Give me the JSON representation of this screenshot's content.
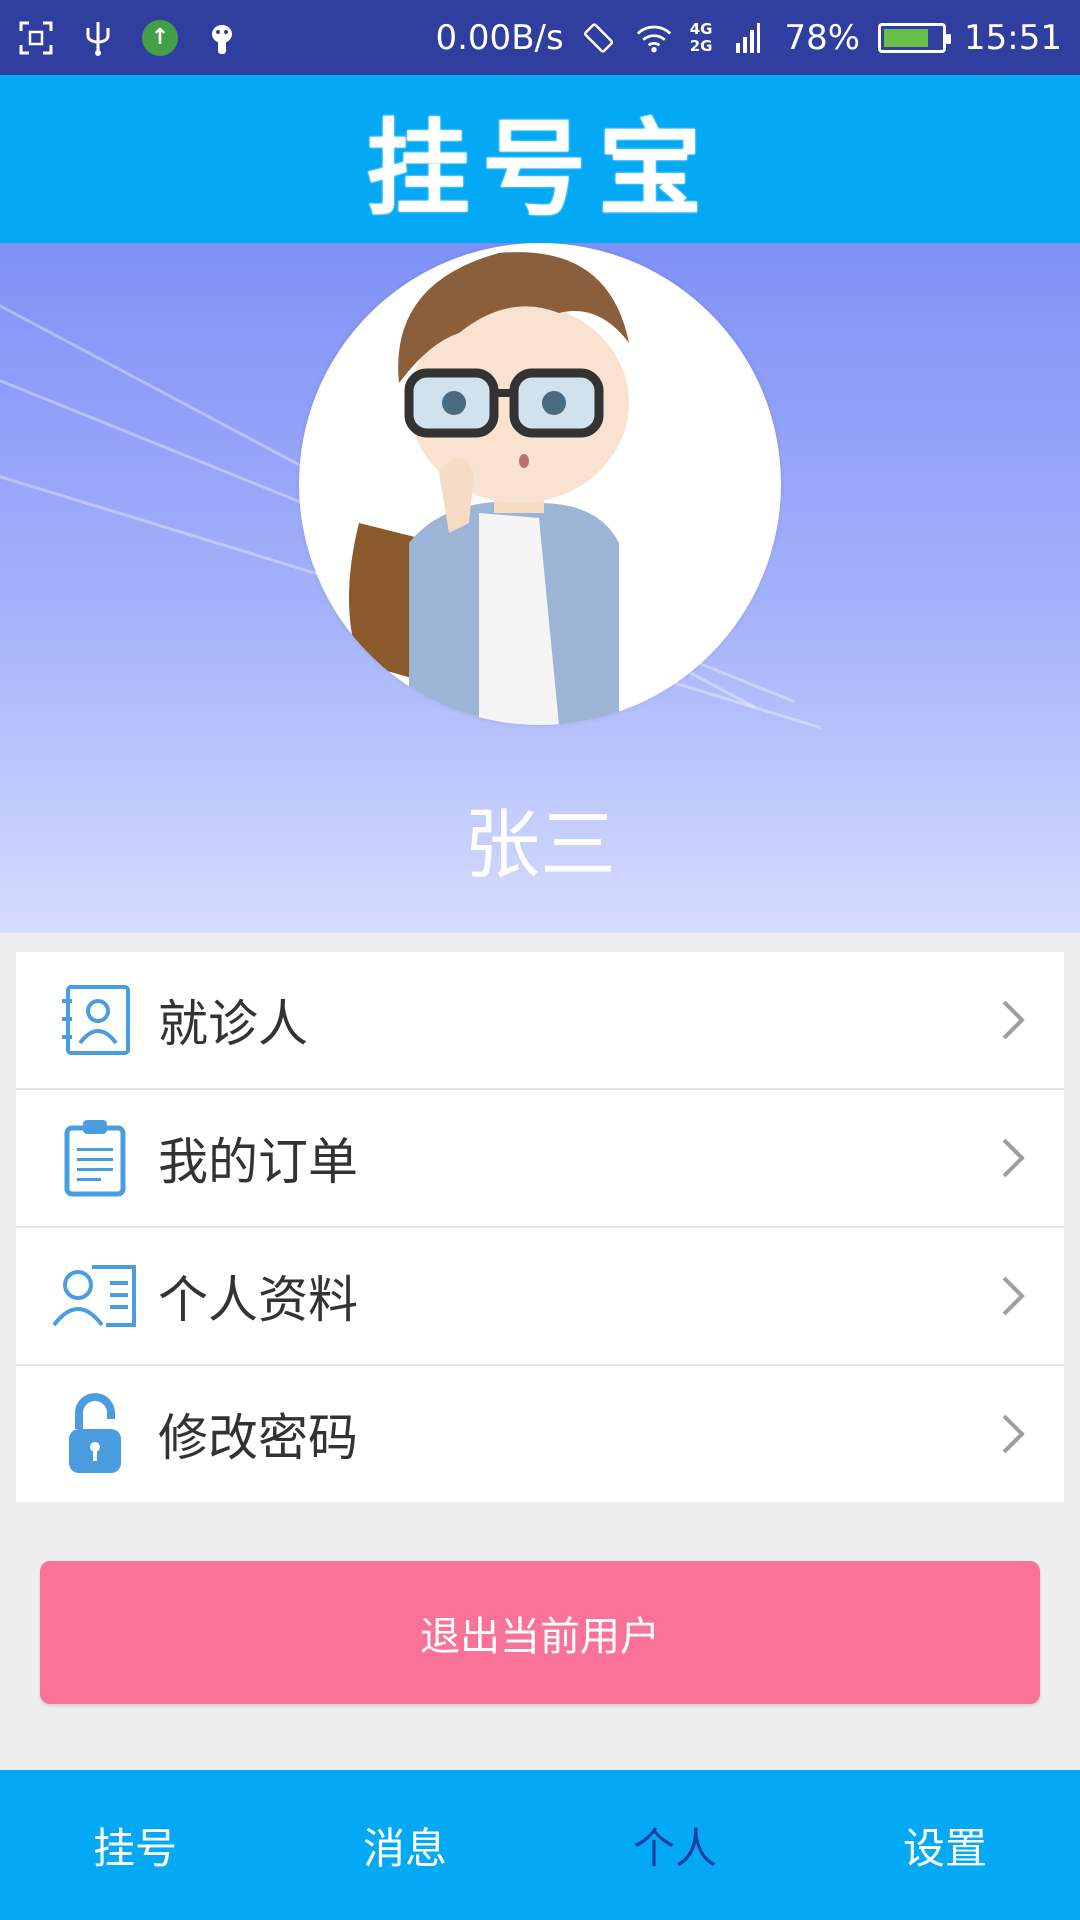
{
  "status_bar": {
    "net_speed": "0.00B/s",
    "network_top": "4G",
    "network_bottom": "2G",
    "battery_percent": "78%",
    "battery_level": 0.78,
    "time": "15:51",
    "icons": [
      "screenshot-icon",
      "usb-icon",
      "upload-icon",
      "android-debug-icon",
      "rotate-icon",
      "wifi-icon",
      "signal-icon",
      "battery-icon"
    ]
  },
  "header": {
    "title": "挂号宝"
  },
  "profile": {
    "name": "张三"
  },
  "menu": {
    "items": [
      {
        "label": "就诊人",
        "icon": "patient-contact-icon"
      },
      {
        "label": "我的订单",
        "icon": "clipboard-icon"
      },
      {
        "label": "个人资料",
        "icon": "profile-card-icon"
      },
      {
        "label": "修改密码",
        "icon": "unlock-icon"
      }
    ]
  },
  "logout": {
    "label": "退出当前用户"
  },
  "bottom_nav": {
    "tabs": [
      {
        "label": "挂号",
        "active": false
      },
      {
        "label": "消息",
        "active": false
      },
      {
        "label": "个人",
        "active": true
      },
      {
        "label": "设置",
        "active": false
      }
    ]
  },
  "colors": {
    "status_bar": "#303f9f",
    "primary": "#03a9f4",
    "logout": "#fb7299",
    "icon_blue": "#4a9ee0",
    "active_tab": "#1a3fa8"
  }
}
